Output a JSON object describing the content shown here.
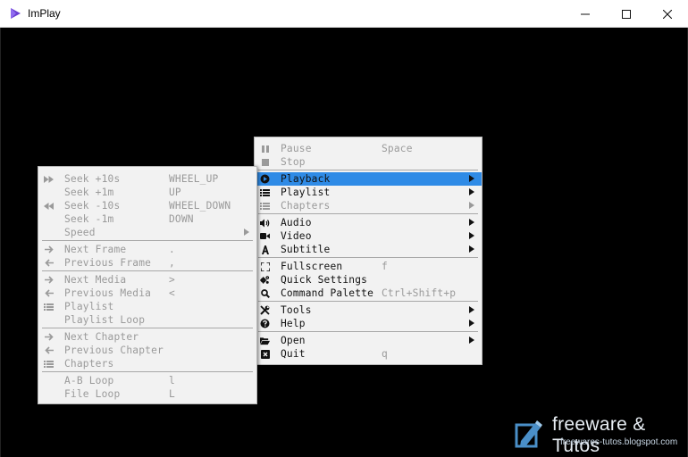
{
  "window": {
    "title": "ImPlay",
    "accent": "#6b3fd1"
  },
  "main_menu": {
    "items": [
      {
        "label": "Pause",
        "shortcut": "Space",
        "icon": "pause-icon",
        "disabled": true
      },
      {
        "label": "Stop",
        "shortcut": "",
        "icon": "stop-icon",
        "disabled": true
      },
      {
        "label": "Playback",
        "shortcut": "",
        "icon": "play-circle-icon",
        "submenu": true,
        "selected": true
      },
      {
        "label": "Playlist",
        "shortcut": "",
        "icon": "list-icon",
        "submenu": true
      },
      {
        "label": "Chapters",
        "shortcut": "",
        "icon": "list-icon",
        "submenu": true,
        "disabled": true
      },
      {
        "label": "Audio",
        "shortcut": "",
        "icon": "speaker-icon",
        "submenu": true
      },
      {
        "label": "Video",
        "shortcut": "",
        "icon": "video-camera-icon",
        "submenu": true
      },
      {
        "label": "Subtitle",
        "shortcut": "",
        "icon": "font-icon",
        "submenu": true
      },
      {
        "label": "Fullscreen",
        "shortcut": "f",
        "icon": "expand-icon"
      },
      {
        "label": "Quick Settings",
        "shortcut": "",
        "icon": "gears-icon"
      },
      {
        "label": "Command Palette",
        "shortcut": "Ctrl+Shift+p",
        "icon": "search-icon"
      },
      {
        "label": "Tools",
        "shortcut": "",
        "icon": "tools-icon",
        "submenu": true
      },
      {
        "label": "Help",
        "shortcut": "",
        "icon": "question-circle-icon",
        "submenu": true
      },
      {
        "label": "Open",
        "shortcut": "",
        "icon": "folder-open-icon",
        "submenu": true
      },
      {
        "label": "Quit",
        "shortcut": "q",
        "icon": "close-square-icon"
      }
    ]
  },
  "playback_menu": {
    "items": [
      {
        "label": "Seek +10s",
        "shortcut": "WHEEL_UP",
        "icon": "forward-icon",
        "disabled": true
      },
      {
        "label": "Seek +1m",
        "shortcut": "UP",
        "icon": "",
        "disabled": true
      },
      {
        "label": "Seek -10s",
        "shortcut": "WHEEL_DOWN",
        "icon": "backward-icon",
        "disabled": true
      },
      {
        "label": "Seek -1m",
        "shortcut": "DOWN",
        "icon": "",
        "disabled": true
      },
      {
        "label": "Speed",
        "shortcut": "",
        "icon": "",
        "disabled": true,
        "submenu": true
      },
      {
        "label": "Next Frame",
        "shortcut": ".",
        "icon": "arrow-right-icon",
        "disabled": true
      },
      {
        "label": "Previous Frame",
        "shortcut": ",",
        "icon": "arrow-left-icon",
        "disabled": true
      },
      {
        "label": "Next Media",
        "shortcut": ">",
        "icon": "arrow-right-icon",
        "disabled": true
      },
      {
        "label": "Previous Media",
        "shortcut": "<",
        "icon": "arrow-left-icon",
        "disabled": true
      },
      {
        "label": "Playlist",
        "shortcut": "",
        "icon": "list-icon",
        "disabled": true
      },
      {
        "label": "Playlist Loop",
        "shortcut": "",
        "icon": "",
        "disabled": true
      },
      {
        "label": "Next Chapter",
        "shortcut": "",
        "icon": "arrow-right-icon",
        "disabled": true
      },
      {
        "label": "Previous Chapter",
        "shortcut": "",
        "icon": "arrow-left-icon",
        "disabled": true
      },
      {
        "label": "Chapters",
        "shortcut": "",
        "icon": "list-icon",
        "disabled": true
      },
      {
        "label": "A-B Loop",
        "shortcut": "l",
        "icon": "",
        "disabled": true
      },
      {
        "label": "File Loop",
        "shortcut": "L",
        "icon": "",
        "disabled": true
      }
    ]
  },
  "watermark": {
    "brand": "freeware & Tutos",
    "site": "freewares-tutos.blogspot.com"
  },
  "colors": {
    "menu_bg": "#f2f2f2",
    "selected_bg": "#2f8be6",
    "disabled_text": "#9a9a9a",
    "video_bg": "#000000"
  }
}
